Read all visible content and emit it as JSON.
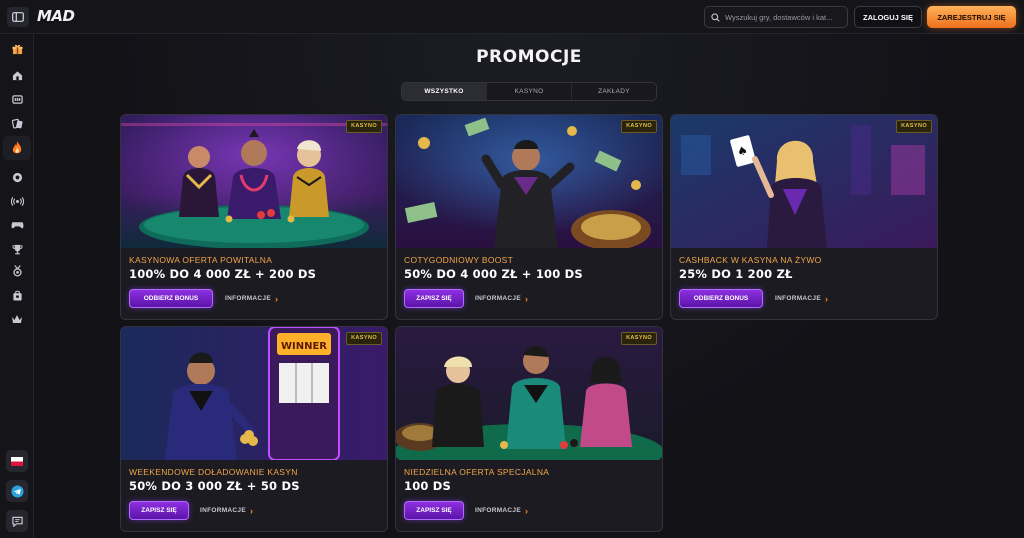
{
  "header": {
    "logo": "MAD",
    "search_placeholder": "Wyszukuj gry, dostawców i kat...",
    "login": "ZALOGUJ SIĘ",
    "register": "ZAREJESTRUJ SIĘ"
  },
  "sidebar": {
    "items": [
      "gift-icon",
      "home-icon",
      "casino-icon",
      "live-casino-icon",
      "hot-icon",
      "football-icon",
      "live-sports-icon",
      "esports-icon",
      "trophy-icon",
      "medal-icon",
      "bag-icon",
      "crown-icon"
    ],
    "footer": [
      "flag-pl-icon",
      "telegram-icon",
      "chat-icon"
    ]
  },
  "page": {
    "title": "PROMOCJE",
    "tabs": [
      "WSZYSTKO",
      "KASYNO",
      "ZAKŁADY"
    ],
    "active_tab": "WSZYSTKO"
  },
  "cards": [
    {
      "badge": "KASYNO",
      "name": "KASYNOWA OFERTA POWITALNA",
      "offer": "100% DO 4 000 ZŁ + 200 DS",
      "cta": "ODBIERZ BONUS",
      "info": "INFORMACJE"
    },
    {
      "badge": "KASYNO",
      "name": "COTYGODNIOWY BOOST",
      "offer": "50% DO 4 000 ZŁ + 100 DS",
      "cta": "ZAPISZ SIĘ",
      "info": "INFORMACJE"
    },
    {
      "badge": "KASYNO",
      "name": "CASHBACK W KASYNA NA ŻYWO",
      "offer": "25% DO 1 200 ZŁ",
      "cta": "ODBIERZ BONUS",
      "info": "INFORMACJE"
    },
    {
      "badge": "KASYNO",
      "name": "WEEKENDOWE DOŁADOWANIE KASYN",
      "offer": "50% DO 3 000 ZŁ + 50 DS",
      "cta": "ZAPISZ SIĘ",
      "info": "INFORMACJE",
      "image_text": "WINNER"
    },
    {
      "badge": "KASYNO",
      "name": "NIEDZIELNA OFERTA SPECJALNA",
      "offer": "100 DS",
      "cta": "ZAPISZ SIĘ",
      "info": "INFORMACJE"
    }
  ],
  "colors": {
    "accent_orange": "#f2a54a",
    "cta_purple": "#7a22d0",
    "badge_gold": "#e0c04a",
    "register_orange": "#ee6f1c"
  }
}
